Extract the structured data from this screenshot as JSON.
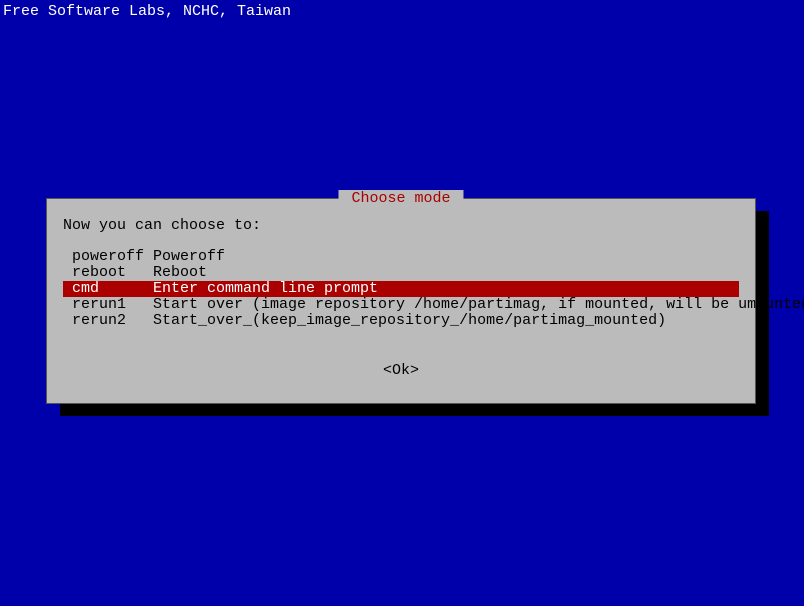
{
  "header": "Free Software Labs, NCHC, Taiwan",
  "dialog": {
    "title": " Choose mode ",
    "prompt": "Now you can choose to:",
    "okLabel": "<Ok>"
  },
  "menu": {
    "selectedIndex": 2,
    "items": [
      {
        "key": "poweroff",
        "label": "Poweroff"
      },
      {
        "key": "reboot",
        "label": "Reboot"
      },
      {
        "key": "cmd",
        "label": "Enter command line prompt"
      },
      {
        "key": "rerun1",
        "label": "Start over (image repository /home/partimag, if mounted, will be umounted)"
      },
      {
        "key": "rerun2",
        "label": "Start_over_(keep_image_repository_/home/partimag_mounted)"
      }
    ]
  }
}
